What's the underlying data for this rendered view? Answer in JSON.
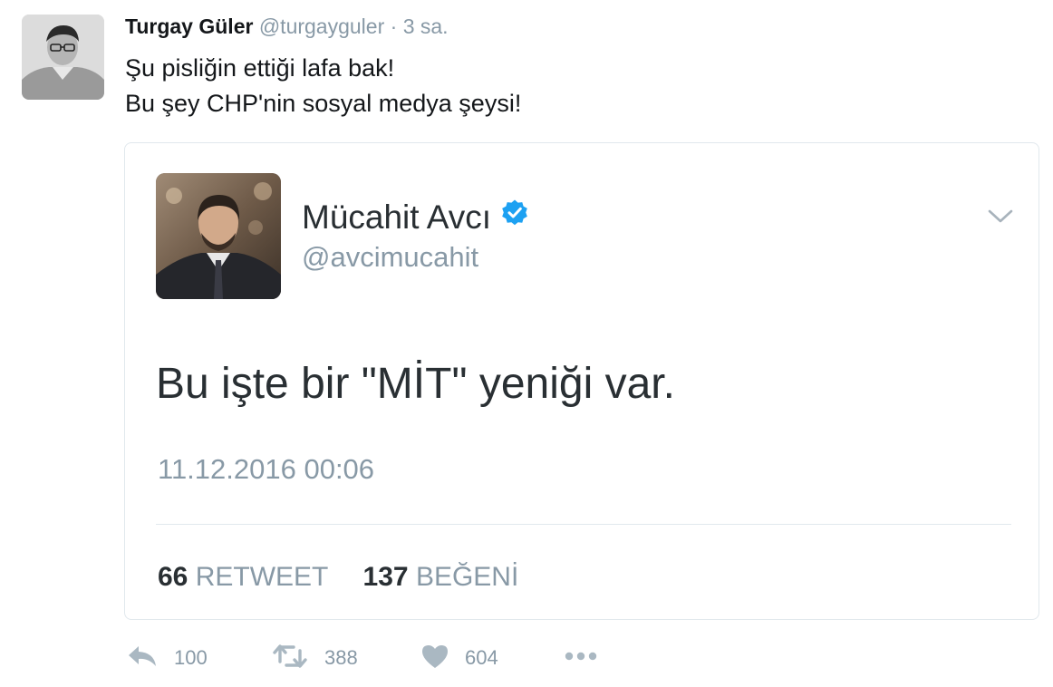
{
  "tweet": {
    "author_name": "Turgay Güler",
    "author_handle": "@turgayguler",
    "separator": "·",
    "time": "3 sa.",
    "lines": [
      "Şu pisliğin ettiği lafa bak!",
      "Bu şey CHP'nin sosyal medya şeysi!"
    ]
  },
  "quoted": {
    "name": "Mücahit Avcı",
    "handle": "@avcimucahit",
    "text": "Bu işte bir \"MİT\" yeniği var.",
    "date": "11.12.2016 00:06",
    "retweets_count": "66",
    "retweets_label": "RETWEET",
    "likes_count": "137",
    "likes_label": "BEĞENİ"
  },
  "actions": {
    "reply_count": "100",
    "retweet_count": "388",
    "like_count": "604"
  },
  "icons": {
    "reply": "reply-icon",
    "retweet": "retweet-icon",
    "like": "heart-icon",
    "more": "more-icon",
    "verified": "verified-badge-icon",
    "chevron": "chevron-down-icon"
  },
  "colors": {
    "muted": "#8899a6",
    "text": "#14171a",
    "verified": "#1da1f2",
    "border": "#e1e8ed"
  }
}
